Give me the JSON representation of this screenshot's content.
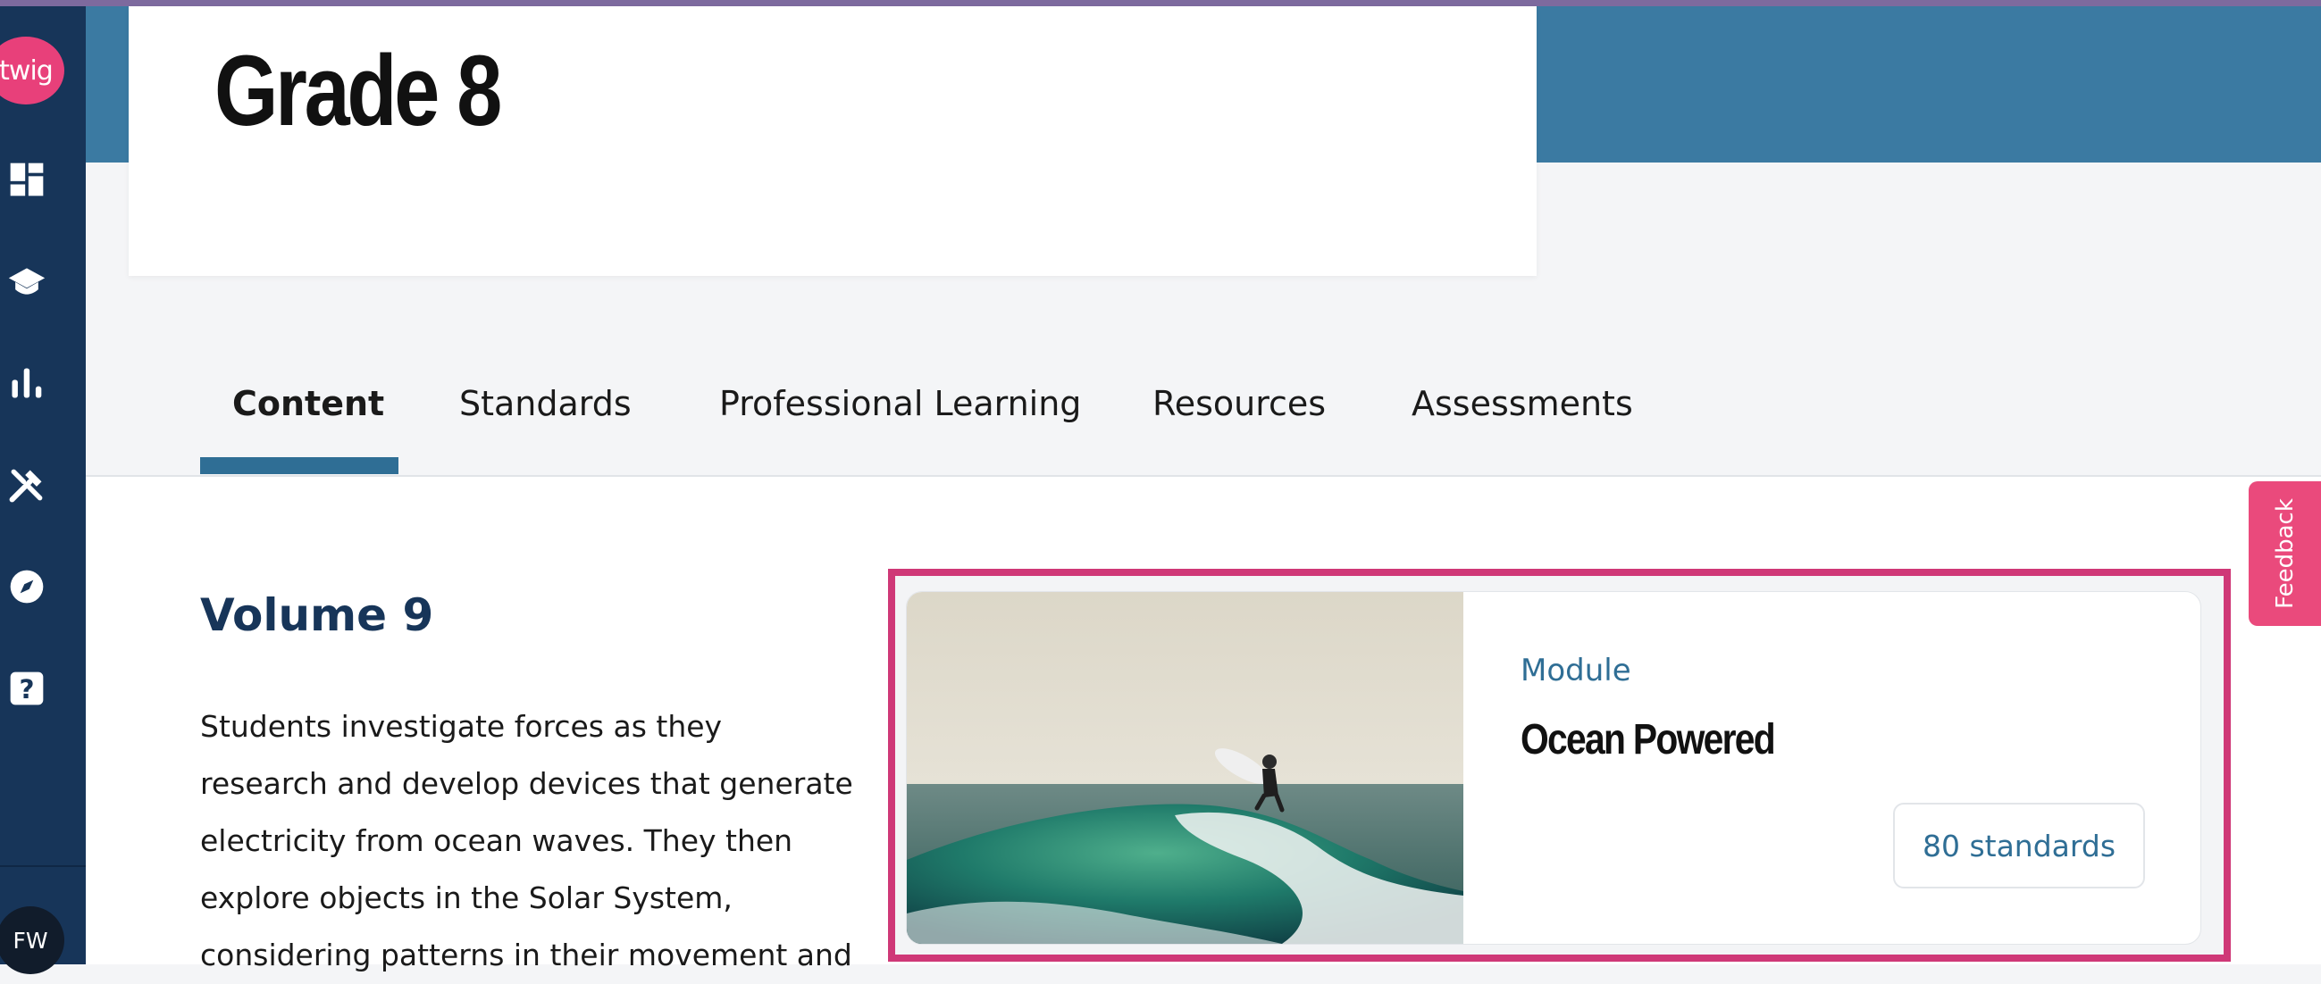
{
  "app": {
    "logo_text": "twig",
    "user_initials": "FW"
  },
  "sidebar": {
    "items": [
      {
        "icon": "dashboard-icon"
      },
      {
        "icon": "graduation-cap-icon"
      },
      {
        "icon": "bar-chart-icon"
      },
      {
        "icon": "tools-icon"
      },
      {
        "icon": "compass-icon"
      },
      {
        "icon": "help-icon"
      }
    ]
  },
  "header": {
    "title": "Grade 8"
  },
  "tabs": [
    {
      "label": "Content",
      "active": true
    },
    {
      "label": "Standards",
      "active": false
    },
    {
      "label": "Professional Learning",
      "active": false
    },
    {
      "label": "Resources",
      "active": false
    },
    {
      "label": "Assessments",
      "active": false
    }
  ],
  "volume": {
    "title": "Volume 9",
    "description": "Students investigate forces as they research and develop devices that generate electricity from ocean waves. They then explore objects in the Solar System, considering patterns in their movement and"
  },
  "module": {
    "type_label": "Module",
    "name": "Ocean Powered",
    "standards_label": "80 standards"
  },
  "feedback": {
    "label": "Feedback"
  },
  "colors": {
    "sidebar": "#173559",
    "accent": "#2f6e95",
    "brand_pink": "#e8407a",
    "highlight": "#cf3877",
    "header_band": "#3b7aa2"
  }
}
